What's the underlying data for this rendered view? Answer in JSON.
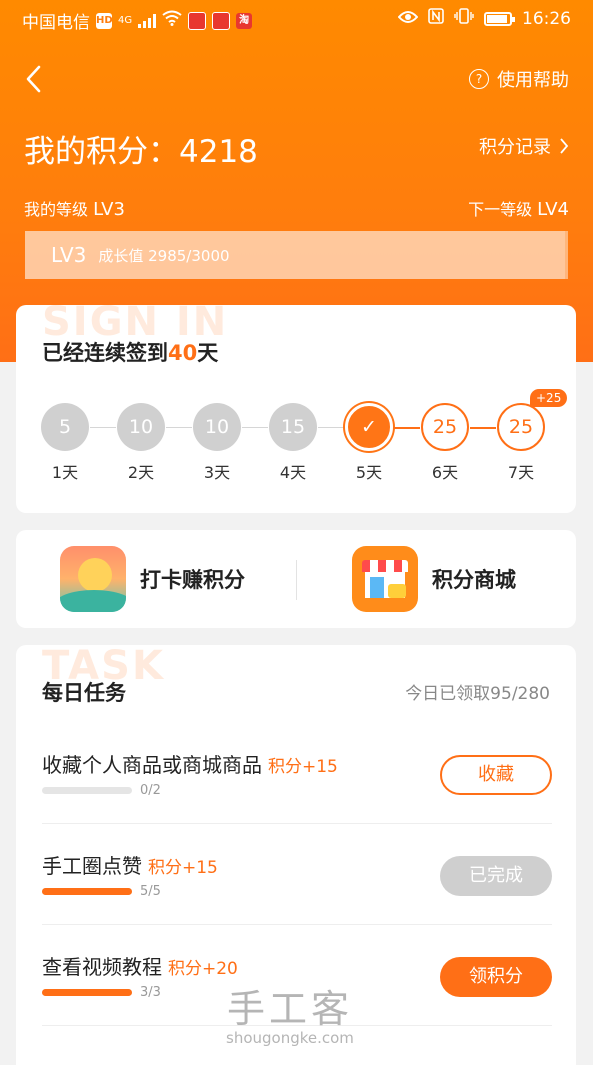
{
  "status_bar": {
    "carrier": "中国电信",
    "hd": "HD",
    "net": "4G",
    "app_icon_3": "淘",
    "time": "16:26"
  },
  "header": {
    "help_label": "使用帮助",
    "points_label": "我的积分：",
    "points_value": "4218",
    "record_label": "积分记录",
    "my_level_label": "我的等级",
    "my_level": "LV3",
    "next_level_label": "下一等级",
    "next_level": "LV4",
    "progress_level": "LV3",
    "progress_text": "成长值 2985/3000",
    "progress_fraction": 0.995
  },
  "signin": {
    "watermark": "SIGN IN",
    "title_prefix": "已经连续签到",
    "streak": "40",
    "title_suffix": "天",
    "days": [
      {
        "value": "5",
        "label": "1天",
        "state": "past"
      },
      {
        "value": "10",
        "label": "2天",
        "state": "past"
      },
      {
        "value": "10",
        "label": "3天",
        "state": "past"
      },
      {
        "value": "15",
        "label": "4天",
        "state": "past"
      },
      {
        "value": "✓",
        "label": "5天",
        "state": "today"
      },
      {
        "value": "25",
        "label": "6天",
        "state": "future"
      },
      {
        "value": "25",
        "label": "7天",
        "state": "future",
        "bonus": "+25"
      }
    ]
  },
  "entries": {
    "checkin_label": "打卡赚积分",
    "shop_label": "积分商城"
  },
  "tasks": {
    "watermark": "TASK",
    "title": "每日任务",
    "count_text": "今日已领取95/280",
    "items": [
      {
        "name": "收藏个人商品或商城商品",
        "reward": "积分+15",
        "progress": "0/2",
        "fraction": 0,
        "button": "收藏",
        "state": "outline"
      },
      {
        "name": "手工圈点赞",
        "reward": "积分+15",
        "progress": "5/5",
        "fraction": 1,
        "button": "已完成",
        "state": "done"
      },
      {
        "name": "查看视频教程",
        "reward": "积分+20",
        "progress": "3/3",
        "fraction": 1,
        "button": "领积分",
        "state": "solid"
      }
    ]
  },
  "site_mark": {
    "cn": "手工客",
    "en": "shougongke.com"
  },
  "colors": {
    "accent": "#ff6f16",
    "header": "#ff8a00"
  }
}
